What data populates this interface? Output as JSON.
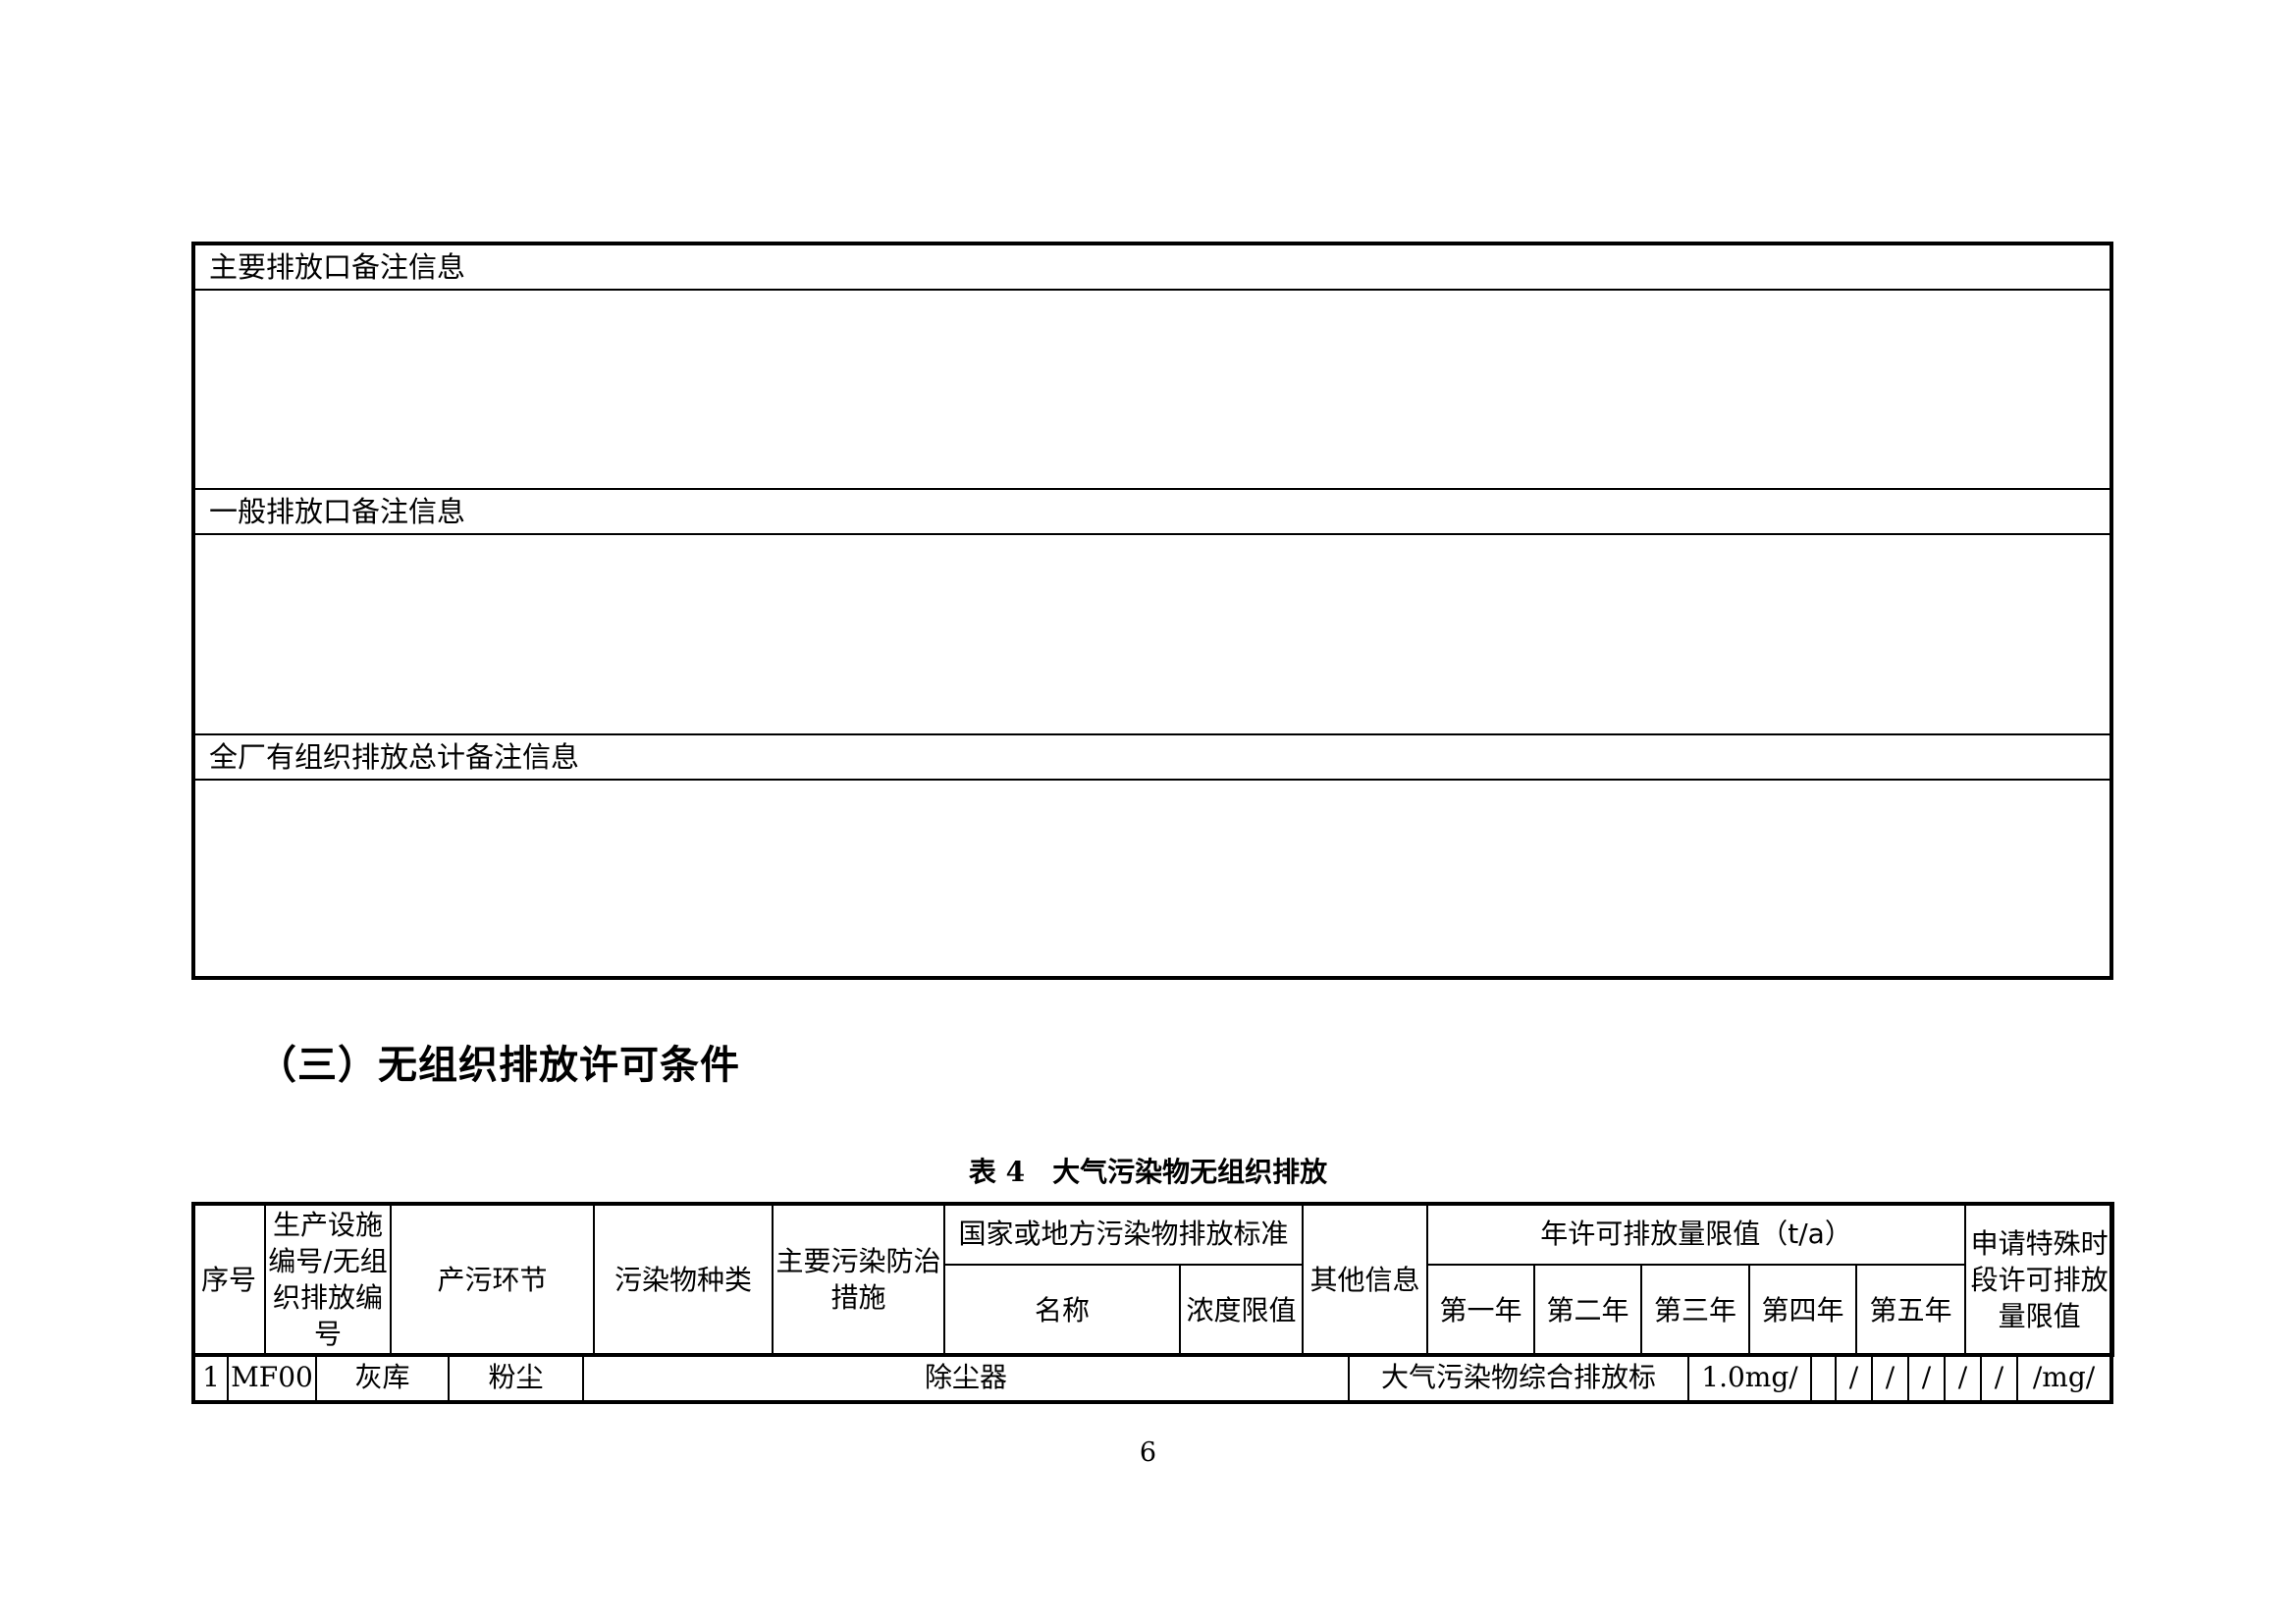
{
  "remarks": {
    "main_outlet": "主要排放口备注信息",
    "general_outlet": "一般排放口备注信息",
    "plant_total": "全厂有组织排放总计备注信息"
  },
  "section_heading": "（三）无组织排放许可条件",
  "table_caption": {
    "number": "表 4",
    "title": "大气污染物无组织排放"
  },
  "table_headers": {
    "seq": "序号",
    "facility_id": "生产设施编号/无组织排放编号",
    "process": "产污环节",
    "pollutant": "污染物种类",
    "control": "主要污染防治措施",
    "standard_group": "国家或地方污染物排放标准",
    "standard_name": "名称",
    "concentration": "浓度限值",
    "other": "其他信息",
    "annual_group": "年许可排放量限值（t/a）",
    "year1": "第一年",
    "year2": "第二年",
    "year3": "第三年",
    "year4": "第四年",
    "year5": "第五年",
    "special": "申请特殊时段许可排放量限值"
  },
  "rows": [
    {
      "seq": "1",
      "facility_id": "MF00",
      "process": "灰库",
      "pollutant": "粉尘",
      "control": "除尘器",
      "standard_name": "大气污染物综合排放标",
      "concentration": "1.0mg/",
      "other": "",
      "year1": "/",
      "year2": "/",
      "year3": "/",
      "year4": "/",
      "year5": "/",
      "special": "/mg/"
    }
  ],
  "page_number": "6"
}
